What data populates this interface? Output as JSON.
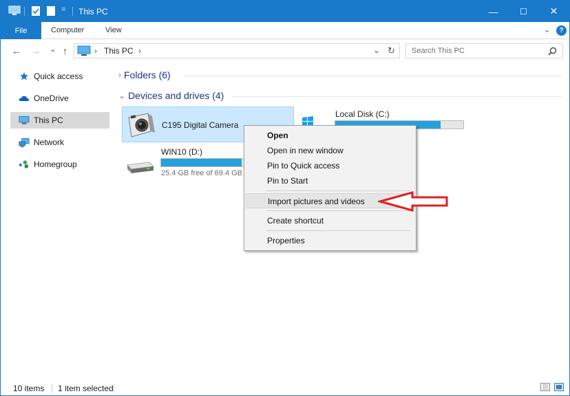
{
  "titlebar": {
    "title": "This PC",
    "qat_dropdown": "=",
    "minimize": "—",
    "maximize": "☐",
    "close": "✕"
  },
  "ribbon": {
    "tabs": [
      "File",
      "Computer",
      "View"
    ],
    "expand": "⌄",
    "help": "?"
  },
  "address": {
    "back": "←",
    "forward": "→",
    "recent": "⌄",
    "up": "↑",
    "breadcrumb_sep": "›",
    "path": "This PC",
    "path_chevron": "›",
    "dropdown": "⌄",
    "refresh": "↻",
    "search_placeholder": "Search This PC",
    "search_icon": "search-icon"
  },
  "nav": {
    "items": [
      {
        "label": "Quick access",
        "icon": "star-icon"
      },
      {
        "label": "OneDrive",
        "icon": "cloud-icon"
      },
      {
        "label": "This PC",
        "icon": "monitor-icon",
        "selected": true
      },
      {
        "label": "Network",
        "icon": "network-icon"
      },
      {
        "label": "Homegroup",
        "icon": "homegroup-icon"
      }
    ]
  },
  "content": {
    "groups": [
      {
        "chevron": "›",
        "label": "Folders (6)"
      },
      {
        "chevron": "⌄",
        "label": "Devices and drives (4)"
      }
    ],
    "drives": [
      {
        "name": "C195 Digital Camera",
        "icon": "camera-icon"
      },
      {
        "name": "Local Disk (C:)",
        "icon": "windows-drive-icon",
        "used_fraction": 0.82
      },
      {
        "name": "WIN10 (D:)",
        "icon": "hard-drive-icon",
        "used_fraction": 0.63,
        "free_text": "25.4 GB free of 69.4 GB"
      }
    ]
  },
  "context_menu": {
    "items": [
      "Open",
      "Open in new window",
      "Pin to Quick access",
      "Pin to Start",
      "Import pictures and videos",
      "Create shortcut",
      "Properties"
    ],
    "highlighted": "Import pictures and videos"
  },
  "status": {
    "count": "10 items",
    "selection": "1 item selected"
  },
  "colors": {
    "accent": "#1979ca",
    "selection": "#cce8ff",
    "drive_bar": "#26a0da",
    "annotation_arrow": "#e02020"
  }
}
